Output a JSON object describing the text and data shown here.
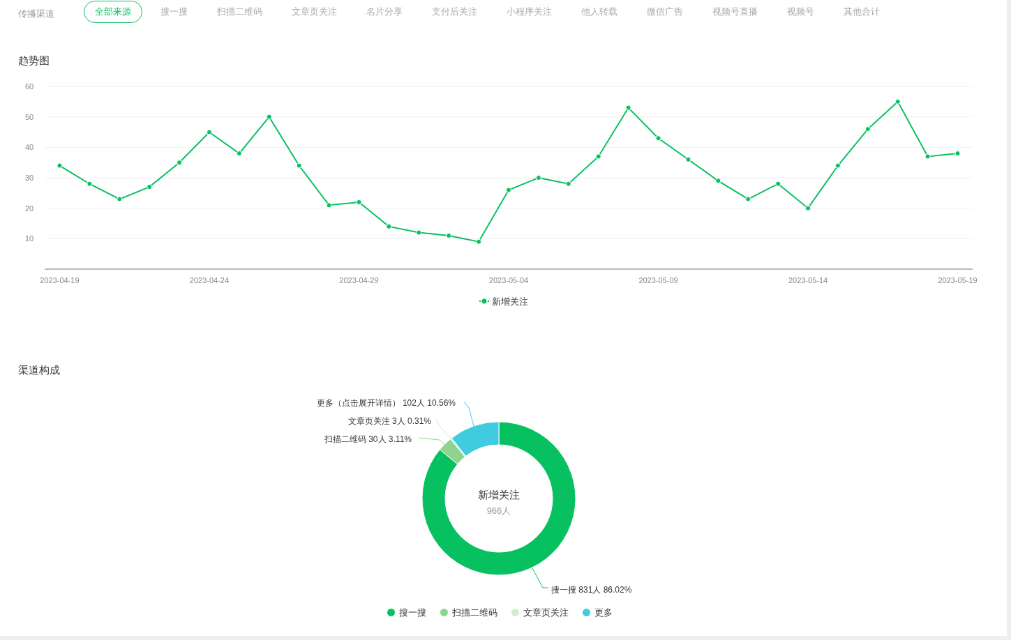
{
  "filter": {
    "label": "传播渠道",
    "tabs": [
      {
        "label": "全部来源",
        "selected": true
      },
      {
        "label": "搜一搜",
        "selected": false
      },
      {
        "label": "扫描二维码",
        "selected": false
      },
      {
        "label": "文章页关注",
        "selected": false
      },
      {
        "label": "名片分享",
        "selected": false
      },
      {
        "label": "支付后关注",
        "selected": false
      },
      {
        "label": "小程序关注",
        "selected": false
      },
      {
        "label": "他人转载",
        "selected": false
      },
      {
        "label": "微信广告",
        "selected": false
      },
      {
        "label": "视频号直播",
        "selected": false
      },
      {
        "label": "视频号",
        "selected": false
      },
      {
        "label": "其他合计",
        "selected": false
      }
    ]
  },
  "trend": {
    "title": "趋势图",
    "chart_data": {
      "type": "line",
      "categories": [
        "2023-04-19",
        null,
        null,
        null,
        null,
        "2023-04-24",
        null,
        null,
        null,
        null,
        "2023-04-29",
        null,
        null,
        null,
        null,
        "2023-05-04",
        null,
        null,
        null,
        null,
        "2023-05-09",
        null,
        null,
        null,
        null,
        "2023-05-14",
        null,
        null,
        null,
        null,
        "2023-05-19"
      ],
      "ylim": [
        0,
        60
      ],
      "grid": true,
      "yticks": [
        10,
        20,
        30,
        40,
        50,
        60
      ],
      "series": [
        {
          "name": "新增关注",
          "color": "#07c160",
          "marker": true,
          "values": [
            34,
            28,
            23,
            27,
            35,
            45,
            38,
            50,
            34,
            21,
            22,
            14,
            12,
            11,
            9,
            26,
            30,
            28,
            37,
            53,
            43,
            36,
            29,
            23,
            28,
            20,
            34,
            46,
            55,
            37,
            38
          ]
        }
      ]
    }
  },
  "composition": {
    "title": "渠道构成",
    "center": {
      "title": "新增关注",
      "total": "966人"
    },
    "chart_data": {
      "type": "donut",
      "categories": [
        "搜一搜",
        "扫描二维码",
        "文章页关注",
        "更多"
      ],
      "values": [
        831,
        30,
        3,
        102
      ],
      "colors": [
        "#07c160",
        "#8fd48e",
        "#cdeecf",
        "#40cce0"
      ],
      "value_labels": [
        "搜一搜 831人 86.02%",
        "扫描二维码 30人 3.11%",
        "文章页关注 3人 0.31%",
        "更多（点击展开详情） 102人 10.56%"
      ]
    }
  }
}
